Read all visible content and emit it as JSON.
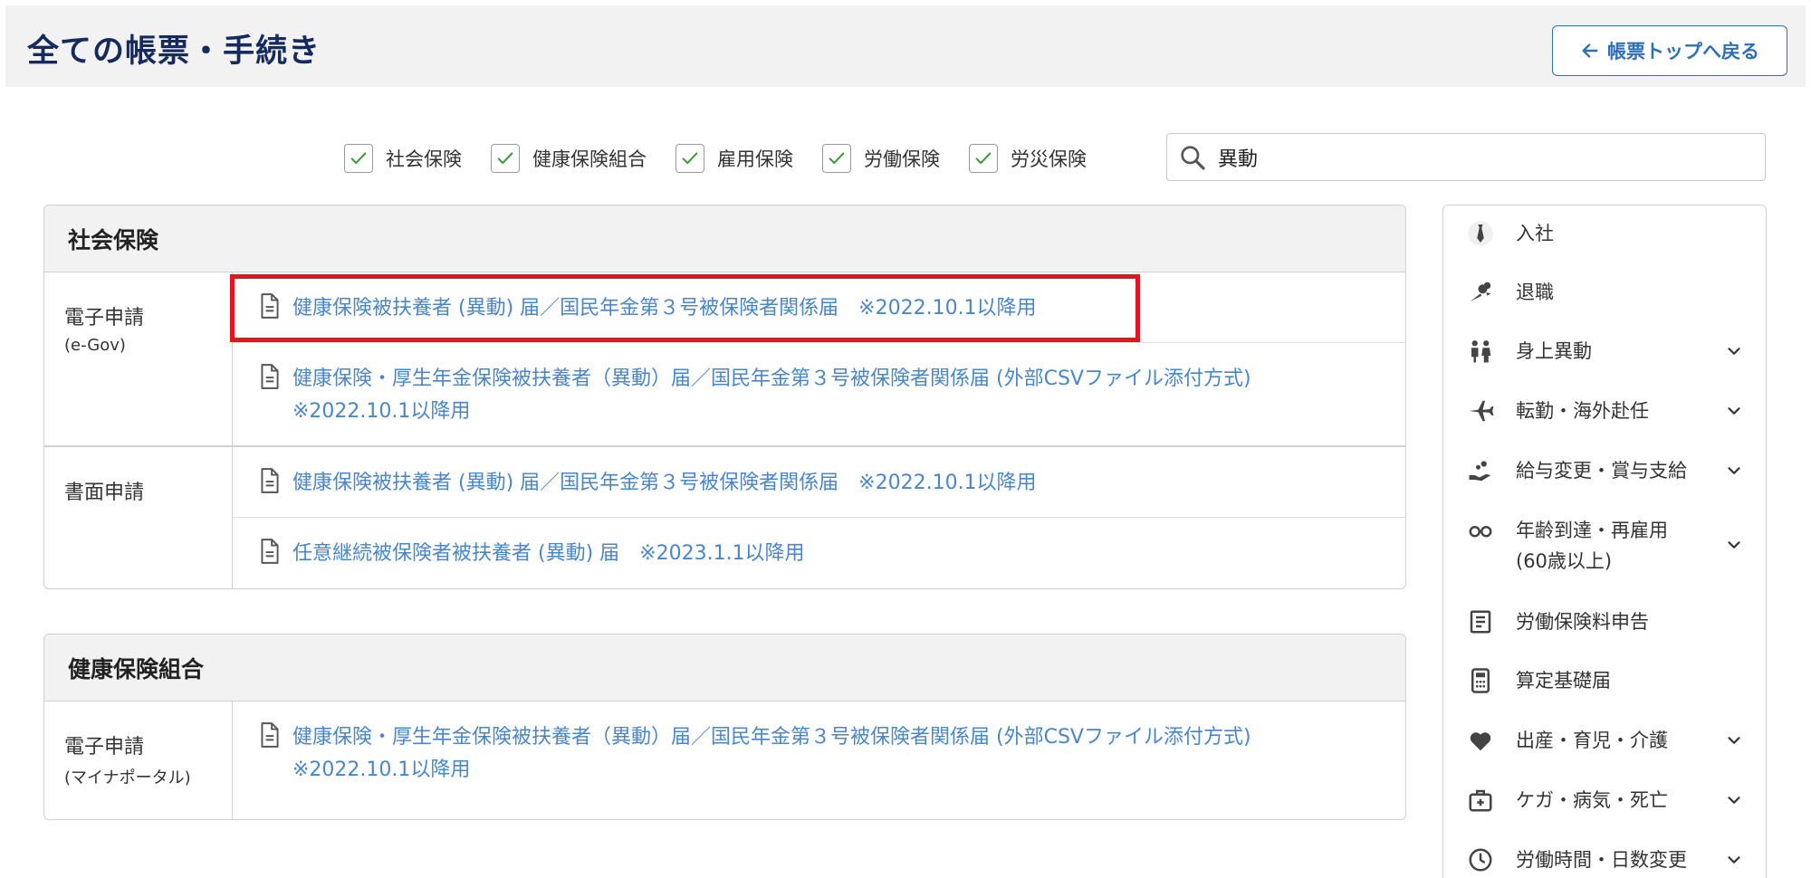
{
  "header": {
    "title": "全ての帳票・手続き",
    "back_label": "帳票トップへ戻る"
  },
  "filters": [
    {
      "label": "社会保険",
      "checked": true
    },
    {
      "label": "健康保険組合",
      "checked": true
    },
    {
      "label": "雇用保険",
      "checked": true
    },
    {
      "label": "労働保険",
      "checked": true
    },
    {
      "label": "労災保険",
      "checked": true
    }
  ],
  "search": {
    "value": "異動"
  },
  "sections": [
    {
      "title": "社会保険",
      "groups": [
        {
          "label": "電子申請",
          "sublabel": "(e-Gov)",
          "links": [
            {
              "text": "健康保険被扶養者 (異動) 届／国民年金第３号被保険者関係届　※2022.10.1以降用"
            },
            {
              "text": "健康保険・厚生年金保険被扶養者（異動）届／国民年金第３号被保険者関係届 (外部CSVファイル添付方式)",
              "text2": "※2022.10.1以降用"
            }
          ]
        },
        {
          "label": "書面申請",
          "links": [
            {
              "text": "健康保険被扶養者 (異動) 届／国民年金第３号被保険者関係届　※2022.10.1以降用"
            },
            {
              "text": "任意継続被保険者被扶養者 (異動) 届　※2023.1.1以降用"
            }
          ]
        }
      ]
    },
    {
      "title": "健康保険組合",
      "groups": [
        {
          "label": "電子申請",
          "sublabel": "(マイナポータル)",
          "links": [
            {
              "text": "健康保険・厚生年金保険被扶養者（異動）届／国民年金第３号被保険者関係届 (外部CSVファイル添付方式)",
              "text2": "※2022.10.1以降用"
            }
          ]
        }
      ]
    }
  ],
  "sidebar": {
    "items": [
      {
        "label": "入社",
        "icon": "necktie-icon",
        "expandable": false
      },
      {
        "label": "退職",
        "icon": "bouquet-icon",
        "expandable": false
      },
      {
        "label": "身上異動",
        "icon": "couple-icon",
        "expandable": true
      },
      {
        "label": "転勤・海外赴任",
        "icon": "airplane-icon",
        "expandable": true
      },
      {
        "label": "給与変更・賞与支給",
        "icon": "salary-hand-icon",
        "expandable": true
      },
      {
        "label": "年齢到達・再雇用",
        "label2": "(60歳以上)",
        "icon": "glasses-icon",
        "expandable": true
      },
      {
        "label": "労働保険料申告",
        "icon": "document-lines-icon",
        "expandable": false
      },
      {
        "label": "算定基礎届",
        "icon": "calculator-icon",
        "expandable": false
      },
      {
        "label": "出産・育児・介護",
        "icon": "heart-icon",
        "expandable": true
      },
      {
        "label": "ケガ・病気・死亡",
        "icon": "first-aid-kit-icon",
        "expandable": true
      },
      {
        "label": "労働時間・日数変更",
        "icon": "clock-icon",
        "expandable": true
      }
    ]
  },
  "colors": {
    "title": "#172a5e",
    "link": "#4a86c8",
    "accent": "#2f6fb8",
    "highlight": "#e8141c",
    "header_bg": "#f2f2f2"
  }
}
